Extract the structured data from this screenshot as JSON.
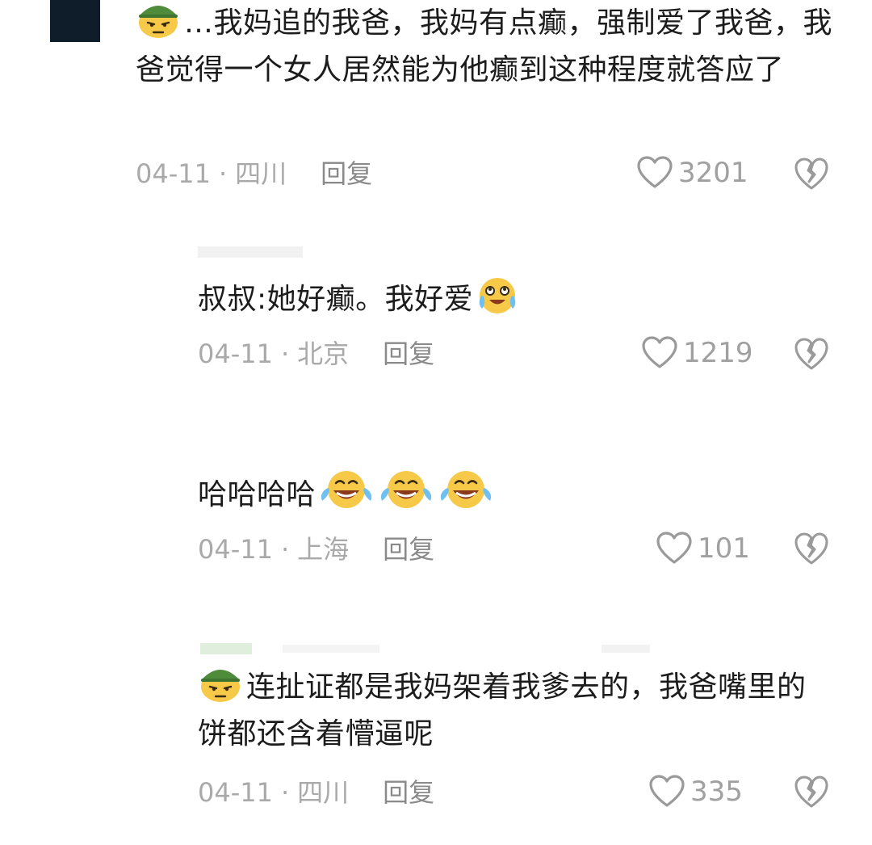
{
  "comments": [
    {
      "text": "…我妈追的我爸，我妈有点癫，强制爱了我爸，我爸觉得一个女人居然能为他癫到这种程度就答应了",
      "date": "04-11",
      "location": "四川",
      "reply_label": "回复",
      "likes": "3201",
      "emoji_before": "army-helmet-face-emoji"
    },
    {
      "text": "叔叔:她好癫。我好爱",
      "date": "04-11",
      "location": "北京",
      "reply_label": "回复",
      "likes": "1219",
      "emoji_after": "crying-laughing-emoji"
    },
    {
      "text": "哈哈哈哈",
      "date": "04-11",
      "location": "上海",
      "reply_label": "回复",
      "likes": "101",
      "emoji_after": "laughing-tears-emoji x3"
    },
    {
      "text": "连扯证都是我妈架着我爹去的，我爸嘴里的饼都还含着懵逼呢",
      "date": "04-11",
      "location": "四川",
      "reply_label": "回复",
      "likes": "335",
      "emoji_before": "army-helmet-face-emoji"
    }
  ],
  "colors": {
    "text": "#1c1c1c",
    "meta": "#a9a9a9",
    "icon": "#9a9a9a",
    "avatar": "#0f1c2a"
  }
}
